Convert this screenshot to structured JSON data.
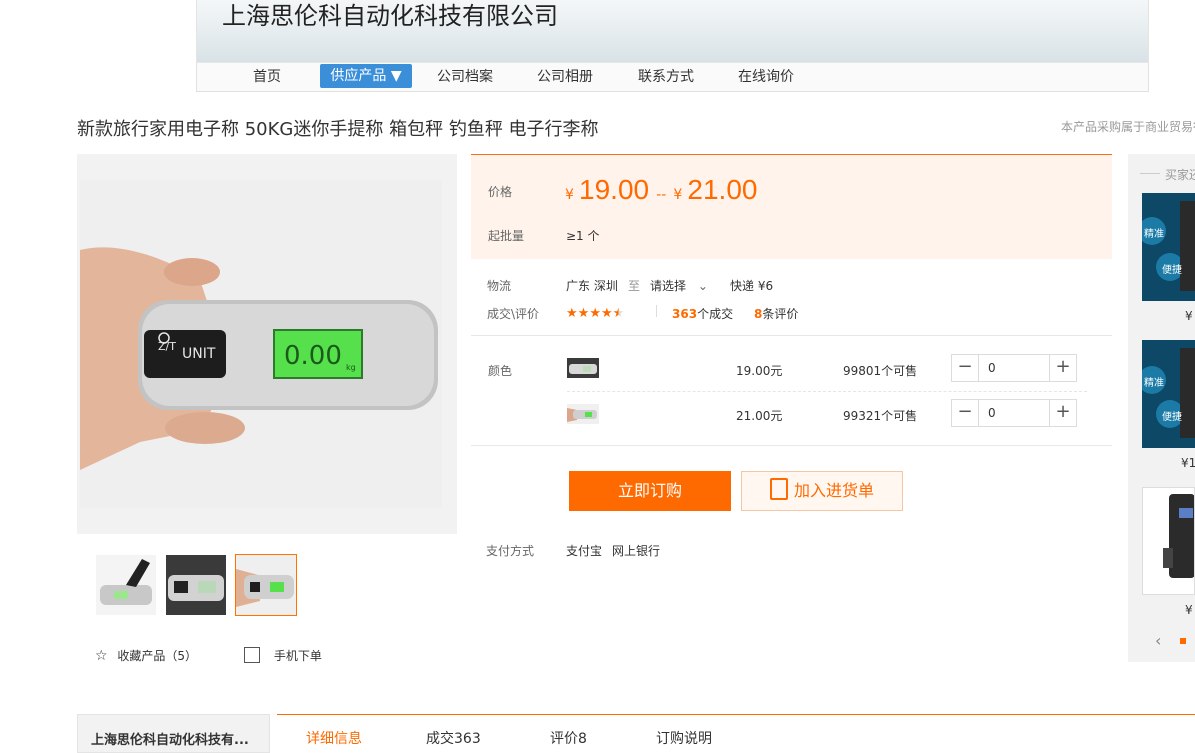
{
  "header": {
    "company_name": "上海思伦科自动化科技有限公司",
    "nav": [
      "首页",
      "供应产品 ▼",
      "公司档案",
      "公司相册",
      "联系方式",
      "在线询价"
    ],
    "active_nav_index": 1
  },
  "product": {
    "title": "新款旅行家用电子称 50KG迷你手提称 箱包秤 钓鱼秤 电子行李称",
    "right_note": "本产品采购属于商业贸易行",
    "display_reading": "0.00",
    "display_unit": "kg",
    "brand_text": "Z/T",
    "unit_button": "UNIT"
  },
  "price": {
    "label": "价格",
    "currency": "¥",
    "low": "19.00",
    "range_sep": "--",
    "high": "21.00",
    "moq_label": "起批量",
    "moq_value": "≥1 个"
  },
  "logistics": {
    "label": "物流",
    "from": "广东 深圳",
    "to_word": "至",
    "select": "请选择",
    "express": "快递 ¥6"
  },
  "reviews": {
    "label": "成交\\评价",
    "rating": 4.5,
    "deals_count": "363",
    "deals_text": "个成交",
    "review_count": "8",
    "review_text": "条评价"
  },
  "variants": {
    "label": "颜色",
    "rows": [
      {
        "price": "19.00元",
        "stock": "99801个可售",
        "qty": "0"
      },
      {
        "price": "21.00元",
        "stock": "99321个可售",
        "qty": "0"
      }
    ]
  },
  "actions": {
    "buy": "立即订购",
    "cart": "加入进货单"
  },
  "payment": {
    "label": "支付方式",
    "methods": [
      "支付宝",
      "网上银行"
    ]
  },
  "gallery": {
    "favorite": "收藏产品（5）",
    "mobile_order": "手机下单",
    "active_thumb": 2
  },
  "sidebar": {
    "title": "买家还",
    "badge_texts": [
      "精准",
      "便捷"
    ],
    "prices": [
      "¥",
      "¥1",
      "¥"
    ]
  },
  "bottom": {
    "company_short": "上海思伦科自动化科技有...",
    "tabs": [
      "详细信息",
      "成交363",
      "评价8",
      "订购说明"
    ],
    "active_tab": 0
  },
  "colors": {
    "accent": "#ff6a00",
    "nav_active": "#3b8fd8",
    "price_bg": "#fff3eb",
    "lcd_green": "#3ed13a"
  }
}
